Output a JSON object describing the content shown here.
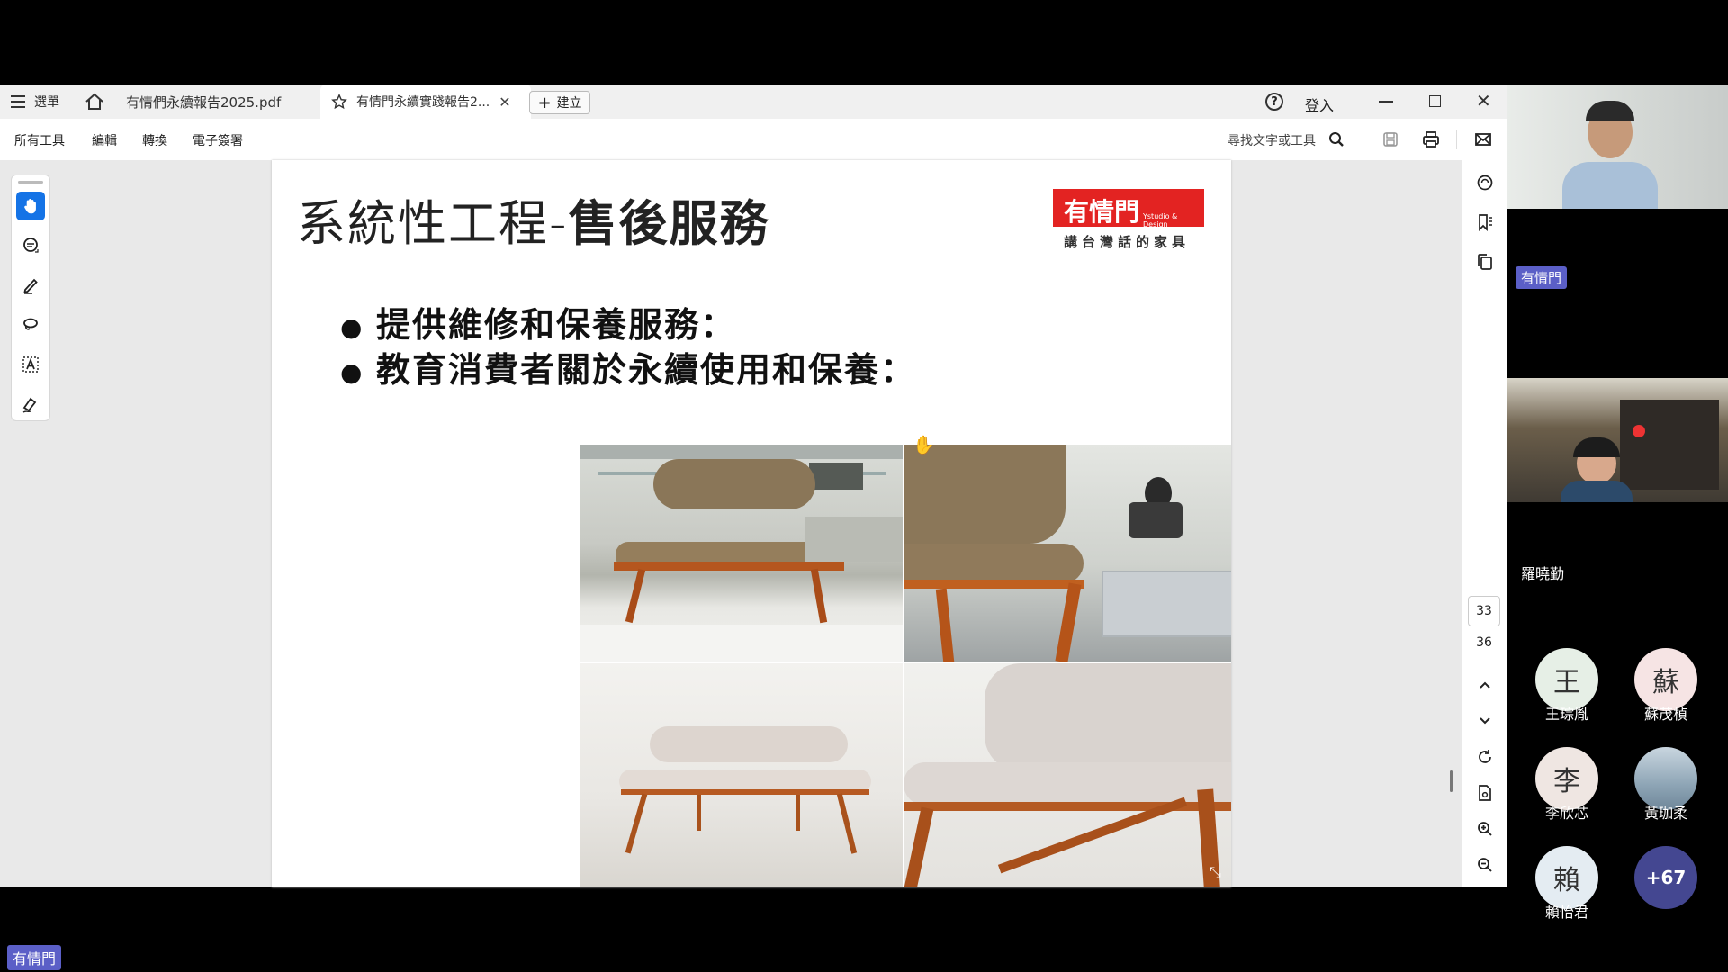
{
  "tabs": {
    "menu_label": "選單",
    "tab1_label": "有情們永續報告2025.pdf",
    "tab2_label": "有情門永續實踐報告2...",
    "create_label": "建立",
    "signin_label": "登入"
  },
  "toolbar": {
    "all_tools": "所有工具",
    "edit": "編輯",
    "convert": "轉換",
    "esign": "電子簽署",
    "search_placeholder": "尋找文字或工具"
  },
  "slide": {
    "title_part1": "系統性工程-",
    "title_part2": "售後服務",
    "logo_main": "有情門",
    "logo_sub": "Ystudio & Design",
    "logo_tagline": "講台灣話的家具",
    "bullets": [
      "提供維修和保養服務：",
      "教育消費者關於永續使用和保養："
    ]
  },
  "page_nav": {
    "current_page": "33",
    "total_pages": "36"
  },
  "participants": {
    "presenter_name": "有情門",
    "video2_name": "羅曉勤",
    "avatars": [
      {
        "initial": "王",
        "name": "王琮胤",
        "color": "#e6efe6"
      },
      {
        "initial": "蘇",
        "name": "蘇茂楨",
        "color": "#f6e4e4"
      },
      {
        "initial": "李",
        "name": "李欣芯",
        "color": "#efe6e2"
      },
      {
        "initial": "",
        "name": "黃珈柔",
        "color": "#9fb4c4"
      },
      {
        "initial": "賴",
        "name": "賴怡君",
        "color": "#e4ecf2"
      }
    ],
    "more_count": "+67"
  },
  "bottom_chip": "有情門",
  "colors": {
    "accent_blue": "#1473e6",
    "logo_red": "#e32322",
    "chip_purple": "#5b5fc7",
    "more_bubble": "#444791"
  }
}
